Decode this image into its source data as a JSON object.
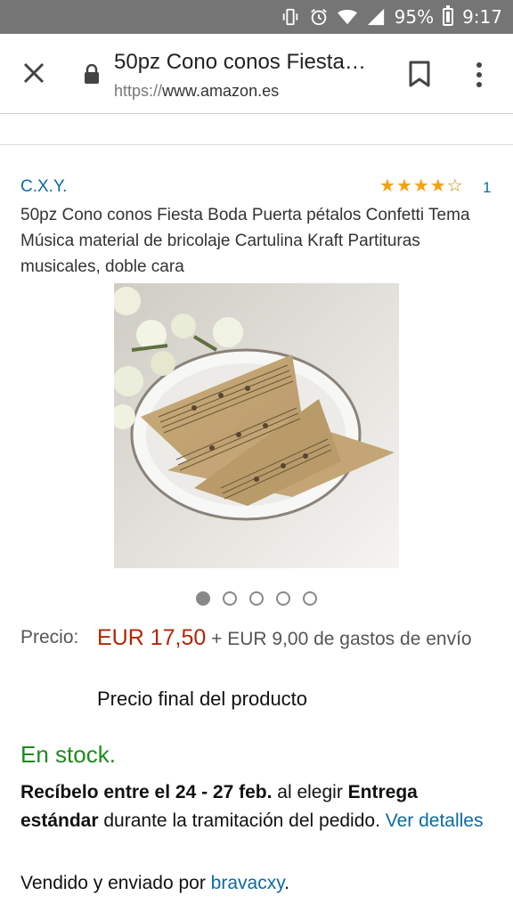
{
  "status_bar": {
    "battery": "95%",
    "time": "9:17"
  },
  "browser": {
    "page_title": "50pz Cono conos Fiesta…",
    "url_protocol": "https://",
    "url_host": "www.amazon.es"
  },
  "product": {
    "brand": "C.X.Y.",
    "rating_stars": 4,
    "rating_max": 5,
    "rating_count": "1",
    "title": "50pz Cono conos Fiesta Boda Puerta pétalos Confetti Tema Música material de bricolaje Cartulina Kraft Partituras musicales, doble cara",
    "image_count": 5,
    "image_active_index": 0
  },
  "pricing": {
    "label": "Precio:",
    "price": "EUR 17,50",
    "shipping": "+ EUR 9,00 de gastos de envío",
    "final_note": "Precio final del producto"
  },
  "availability": {
    "stock": "En stock.",
    "delivery_bold_1": "Recíbelo entre el 24 - 27 feb.",
    "delivery_text_1": " al elegir ",
    "delivery_bold_2": "Entrega estándar",
    "delivery_text_2": " durante la tramitación del pedido. ",
    "delivery_link": "Ver detalles",
    "sold_by_text": "Vendido y enviado por ",
    "sold_by_link": "bravacxy",
    "sold_by_end": "."
  },
  "colors": {
    "link": "#0c6aa3",
    "price": "#b12704",
    "in_stock": "#1e8a1e",
    "star": "#f2a10f"
  }
}
